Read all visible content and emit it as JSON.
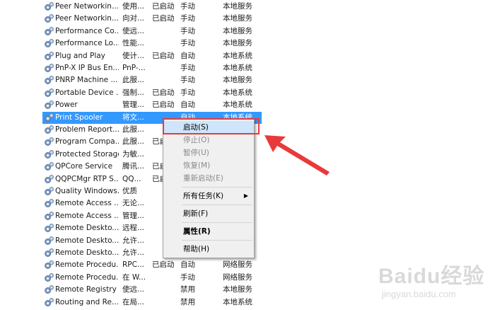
{
  "services": [
    {
      "name": "Peer Networkin...",
      "desc": "使用...",
      "status": "已启动",
      "startup": "手动",
      "logon": "本地服务"
    },
    {
      "name": "Peer Networkin...",
      "desc": "向对...",
      "status": "已启动",
      "startup": "手动",
      "logon": "本地服务"
    },
    {
      "name": "Performance Co...",
      "desc": "使远...",
      "status": "",
      "startup": "手动",
      "logon": "本地服务"
    },
    {
      "name": "Performance Lo...",
      "desc": "性能...",
      "status": "",
      "startup": "手动",
      "logon": "本地服务"
    },
    {
      "name": "Plug and Play",
      "desc": "使计...",
      "status": "已启动",
      "startup": "自动",
      "logon": "本地系统"
    },
    {
      "name": "PnP-X IP Bus En...",
      "desc": "PnP-...",
      "status": "",
      "startup": "手动",
      "logon": "本地系统"
    },
    {
      "name": "PNRP Machine ...",
      "desc": "此服...",
      "status": "",
      "startup": "手动",
      "logon": "本地服务"
    },
    {
      "name": "Portable Device ...",
      "desc": "强制...",
      "status": "已启动",
      "startup": "手动",
      "logon": "本地系统"
    },
    {
      "name": "Power",
      "desc": "管理...",
      "status": "已启动",
      "startup": "自动",
      "logon": "本地系统"
    },
    {
      "name": "Print Spooler",
      "desc": "将文...",
      "status": "",
      "startup": "自动",
      "logon": "本地系统"
    },
    {
      "name": "Problem Report...",
      "desc": "此服...",
      "status": "",
      "startup": "",
      "logon": ""
    },
    {
      "name": "Program Compa...",
      "desc": "此服...",
      "status": "已启",
      "startup": "",
      "logon": ""
    },
    {
      "name": "Protected Storage",
      "desc": "为敏...",
      "status": "",
      "startup": "",
      "logon": ""
    },
    {
      "name": "QPCore Service",
      "desc": "腾讯...",
      "status": "已启",
      "startup": "",
      "logon": ""
    },
    {
      "name": "QQPCMgr RTP S...",
      "desc": "QQ...",
      "status": "已启",
      "startup": "",
      "logon": ""
    },
    {
      "name": "Quality Windows...",
      "desc": "优质",
      "status": "",
      "startup": "",
      "logon": ""
    },
    {
      "name": "Remote Access ...",
      "desc": "无论...",
      "status": "",
      "startup": "",
      "logon": ""
    },
    {
      "name": "Remote Access ...",
      "desc": "管理...",
      "status": "",
      "startup": "",
      "logon": ""
    },
    {
      "name": "Remote Deskto...",
      "desc": "远程...",
      "status": "",
      "startup": "",
      "logon": ""
    },
    {
      "name": "Remote Deskto...",
      "desc": "允许...",
      "status": "",
      "startup": "",
      "logon": ""
    },
    {
      "name": "Remote Deskto...",
      "desc": "允许...",
      "status": "",
      "startup": "",
      "logon": ""
    },
    {
      "name": "Remote Procedu...",
      "desc": "RPC...",
      "status": "已启动",
      "startup": "自动",
      "logon": "网络服务"
    },
    {
      "name": "Remote Procedu...",
      "desc": "在 W...",
      "status": "",
      "startup": "手动",
      "logon": "网络服务"
    },
    {
      "name": "Remote Registry",
      "desc": "使远...",
      "status": "",
      "startup": "禁用",
      "logon": "本地服务"
    },
    {
      "name": "Routing and Re...",
      "desc": "在局...",
      "status": "",
      "startup": "禁用",
      "logon": "本地系统"
    }
  ],
  "selected_index": 9,
  "context_menu": {
    "start": "启动(S)",
    "stop": "停止(O)",
    "pause": "暂停(U)",
    "resume": "恢复(M)",
    "restart": "重新启动(E)",
    "all_tasks": "所有任务(K)",
    "refresh": "刷新(F)",
    "properties": "属性(R)",
    "help": "帮助(H)"
  },
  "watermark": {
    "logo": "Baidu经验",
    "url": "jingyan.baidu.com"
  },
  "colors": {
    "selection": "#3399ff",
    "highlight_box": "#e83a3a",
    "arrow": "#e83a3a"
  },
  "icons": [
    "service-gear-icon",
    "submenu-arrow-icon",
    "pointer-arrow-icon"
  ]
}
